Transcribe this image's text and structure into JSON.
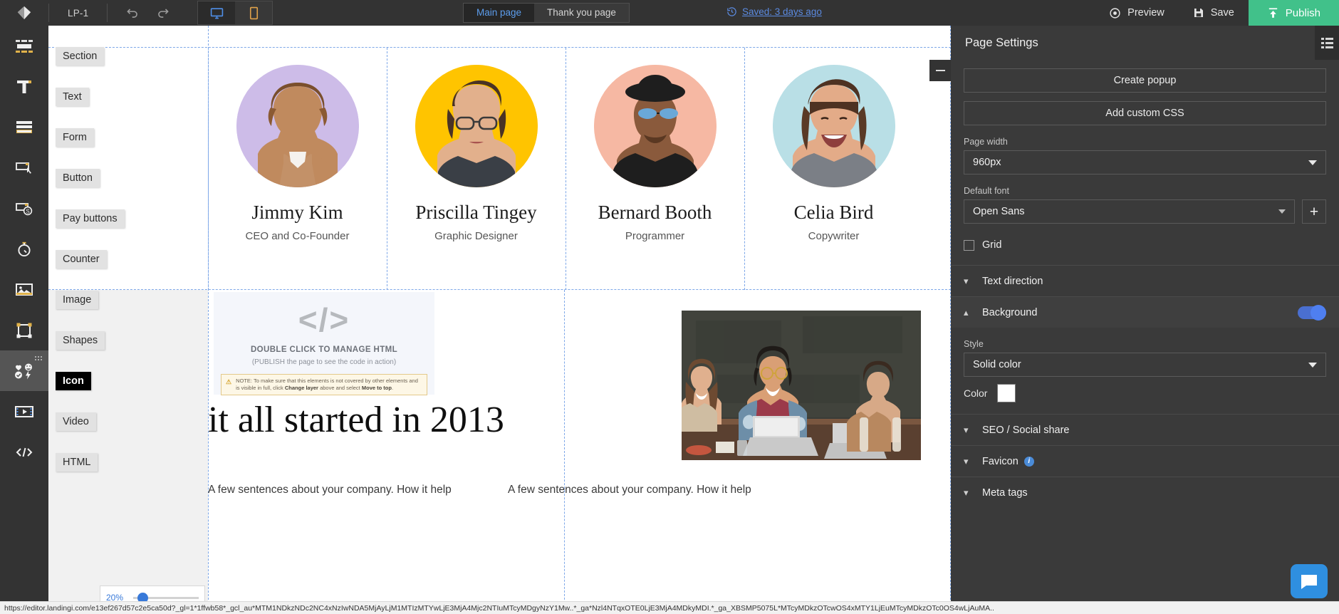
{
  "topbar": {
    "logo_icon": "landingi-logo-icon",
    "project_name": "LP-1",
    "undo_icon": "undo-icon",
    "redo_icon": "redo-icon",
    "desktop_icon": "desktop-monitor-icon",
    "mobile_icon": "mobile-phone-icon",
    "tabs": [
      {
        "label": "Main page",
        "active": true
      },
      {
        "label": "Thank you page",
        "active": false
      }
    ],
    "saved_label": "Saved: 3 days ago",
    "saved_icon": "history-clock-icon",
    "preview_label": "Preview",
    "preview_icon": "eye-icon",
    "save_label": "Save",
    "save_icon": "floppy-disk-icon",
    "publish_label": "Publish",
    "publish_icon": "upload-arrow-icon",
    "publish_color": "#41c18a",
    "accent_link_color": "#5b8ae0"
  },
  "rail": {
    "items": [
      {
        "name": "section",
        "icon": "section-layout-icon",
        "active": false
      },
      {
        "name": "text",
        "icon": "text-T-icon",
        "active": false
      },
      {
        "name": "form",
        "icon": "form-rows-icon",
        "active": false
      },
      {
        "name": "button",
        "icon": "button-cursor-icon",
        "active": false
      },
      {
        "name": "pay-buttons",
        "icon": "pay-dollar-icon",
        "active": false
      },
      {
        "name": "counter",
        "icon": "stopwatch-icon",
        "active": false
      },
      {
        "name": "image",
        "icon": "picture-icon",
        "active": false
      },
      {
        "name": "shapes",
        "icon": "shape-frame-icon",
        "active": false
      },
      {
        "name": "icon",
        "icon": "emoji-icons-icon",
        "active": true
      },
      {
        "name": "video",
        "icon": "film-play-icon",
        "active": false
      },
      {
        "name": "html",
        "icon": "code-tags-icon",
        "active": false
      }
    ]
  },
  "palette": {
    "items": [
      {
        "label": "Section",
        "selected": false
      },
      {
        "label": "Text",
        "selected": false
      },
      {
        "label": "Form",
        "selected": false
      },
      {
        "label": "Button",
        "selected": false
      },
      {
        "label": "Pay buttons",
        "selected": false
      },
      {
        "label": "Counter",
        "selected": false
      },
      {
        "label": "Image",
        "selected": false
      },
      {
        "label": "Shapes",
        "selected": false
      },
      {
        "label": "Icon",
        "selected": true
      },
      {
        "label": "Video",
        "selected": false
      },
      {
        "label": "HTML",
        "selected": false
      }
    ]
  },
  "canvas": {
    "team": [
      {
        "name": "Jimmy Kim",
        "role": "CEO and Co-Founder",
        "bg": "#cdbce8"
      },
      {
        "name": "Priscilla Tingey",
        "role": "Graphic Designer",
        "bg": "#ffc400"
      },
      {
        "name": "Bernard Booth",
        "role": "Programmer",
        "bg": "#f6b8a3"
      },
      {
        "name": "Celia Bird",
        "role": "Copywriter",
        "bg": "#b9dfe6"
      }
    ],
    "html_widget": {
      "code_glyph": "</>",
      "title": "DOUBLE CLICK TO MANAGE HTML",
      "subtitle": "(PUBLISH the page to see the code in action)",
      "note_prefix": "NOTE: To make sure that this elements is not covered by other elements and is visible in full, click",
      "note_bold": "Change layer",
      "note_suffix": "above and select",
      "note_bold2": "Move to top",
      "note_end": "."
    },
    "heading": "it all started in 2013",
    "blurb_left": "A few sentences about your company. How it help",
    "blurb_right": "A few sentences about your company. How it help",
    "zoom_value": "20%",
    "collapse_icon": "minimize-icon"
  },
  "settings": {
    "title": "Page Settings",
    "gear_icon": "panel-list-icon",
    "create_popup_label": "Create popup",
    "add_custom_css_label": "Add custom CSS",
    "page_width_label": "Page width",
    "page_width_value": "960px",
    "default_font_label": "Default font",
    "default_font_value": "Open Sans",
    "add_font_label": "+",
    "grid_label": "Grid",
    "grid_checked": false,
    "sections": [
      {
        "label": "Text direction",
        "open": false,
        "chevron": "chevron-down-icon"
      },
      {
        "label": "Background",
        "open": true,
        "chevron": "chevron-up-icon",
        "toggle": true
      }
    ],
    "style_label": "Style",
    "style_value": "Solid color",
    "color_label": "Color",
    "color_value": "#ffffff",
    "sections_bottom": [
      {
        "label": "SEO / Social share",
        "open": false,
        "info": false
      },
      {
        "label": "Favicon",
        "open": false,
        "info": true
      },
      {
        "label": "Meta tags",
        "open": false,
        "info": false
      }
    ],
    "toggle_color": "#4f7ff0"
  },
  "chat": {
    "icon": "chat-bubble-icon",
    "color": "#2f8fe0"
  },
  "statusbar": {
    "url": "https://editor.landingi.com/e13ef267d57c2e5ca50d?_gl=1*1ffwb58*_gcl_au*MTM1NDkzNDc2NC4xNzIwNDA5MjAyLjM1MTIzMTYwLjE3MjA4Mjc2NTIuMTcyMDgyNzY1Mw..*_ga*Nzl4NTqxOTE0LjE3MjA4MDkyMDI.*_ga_XBSMP5075L*MTcyMDkzOTcwOS4xMTY1LjEuMTcyMDkzOTc0OS4wLjAuMA.."
  }
}
